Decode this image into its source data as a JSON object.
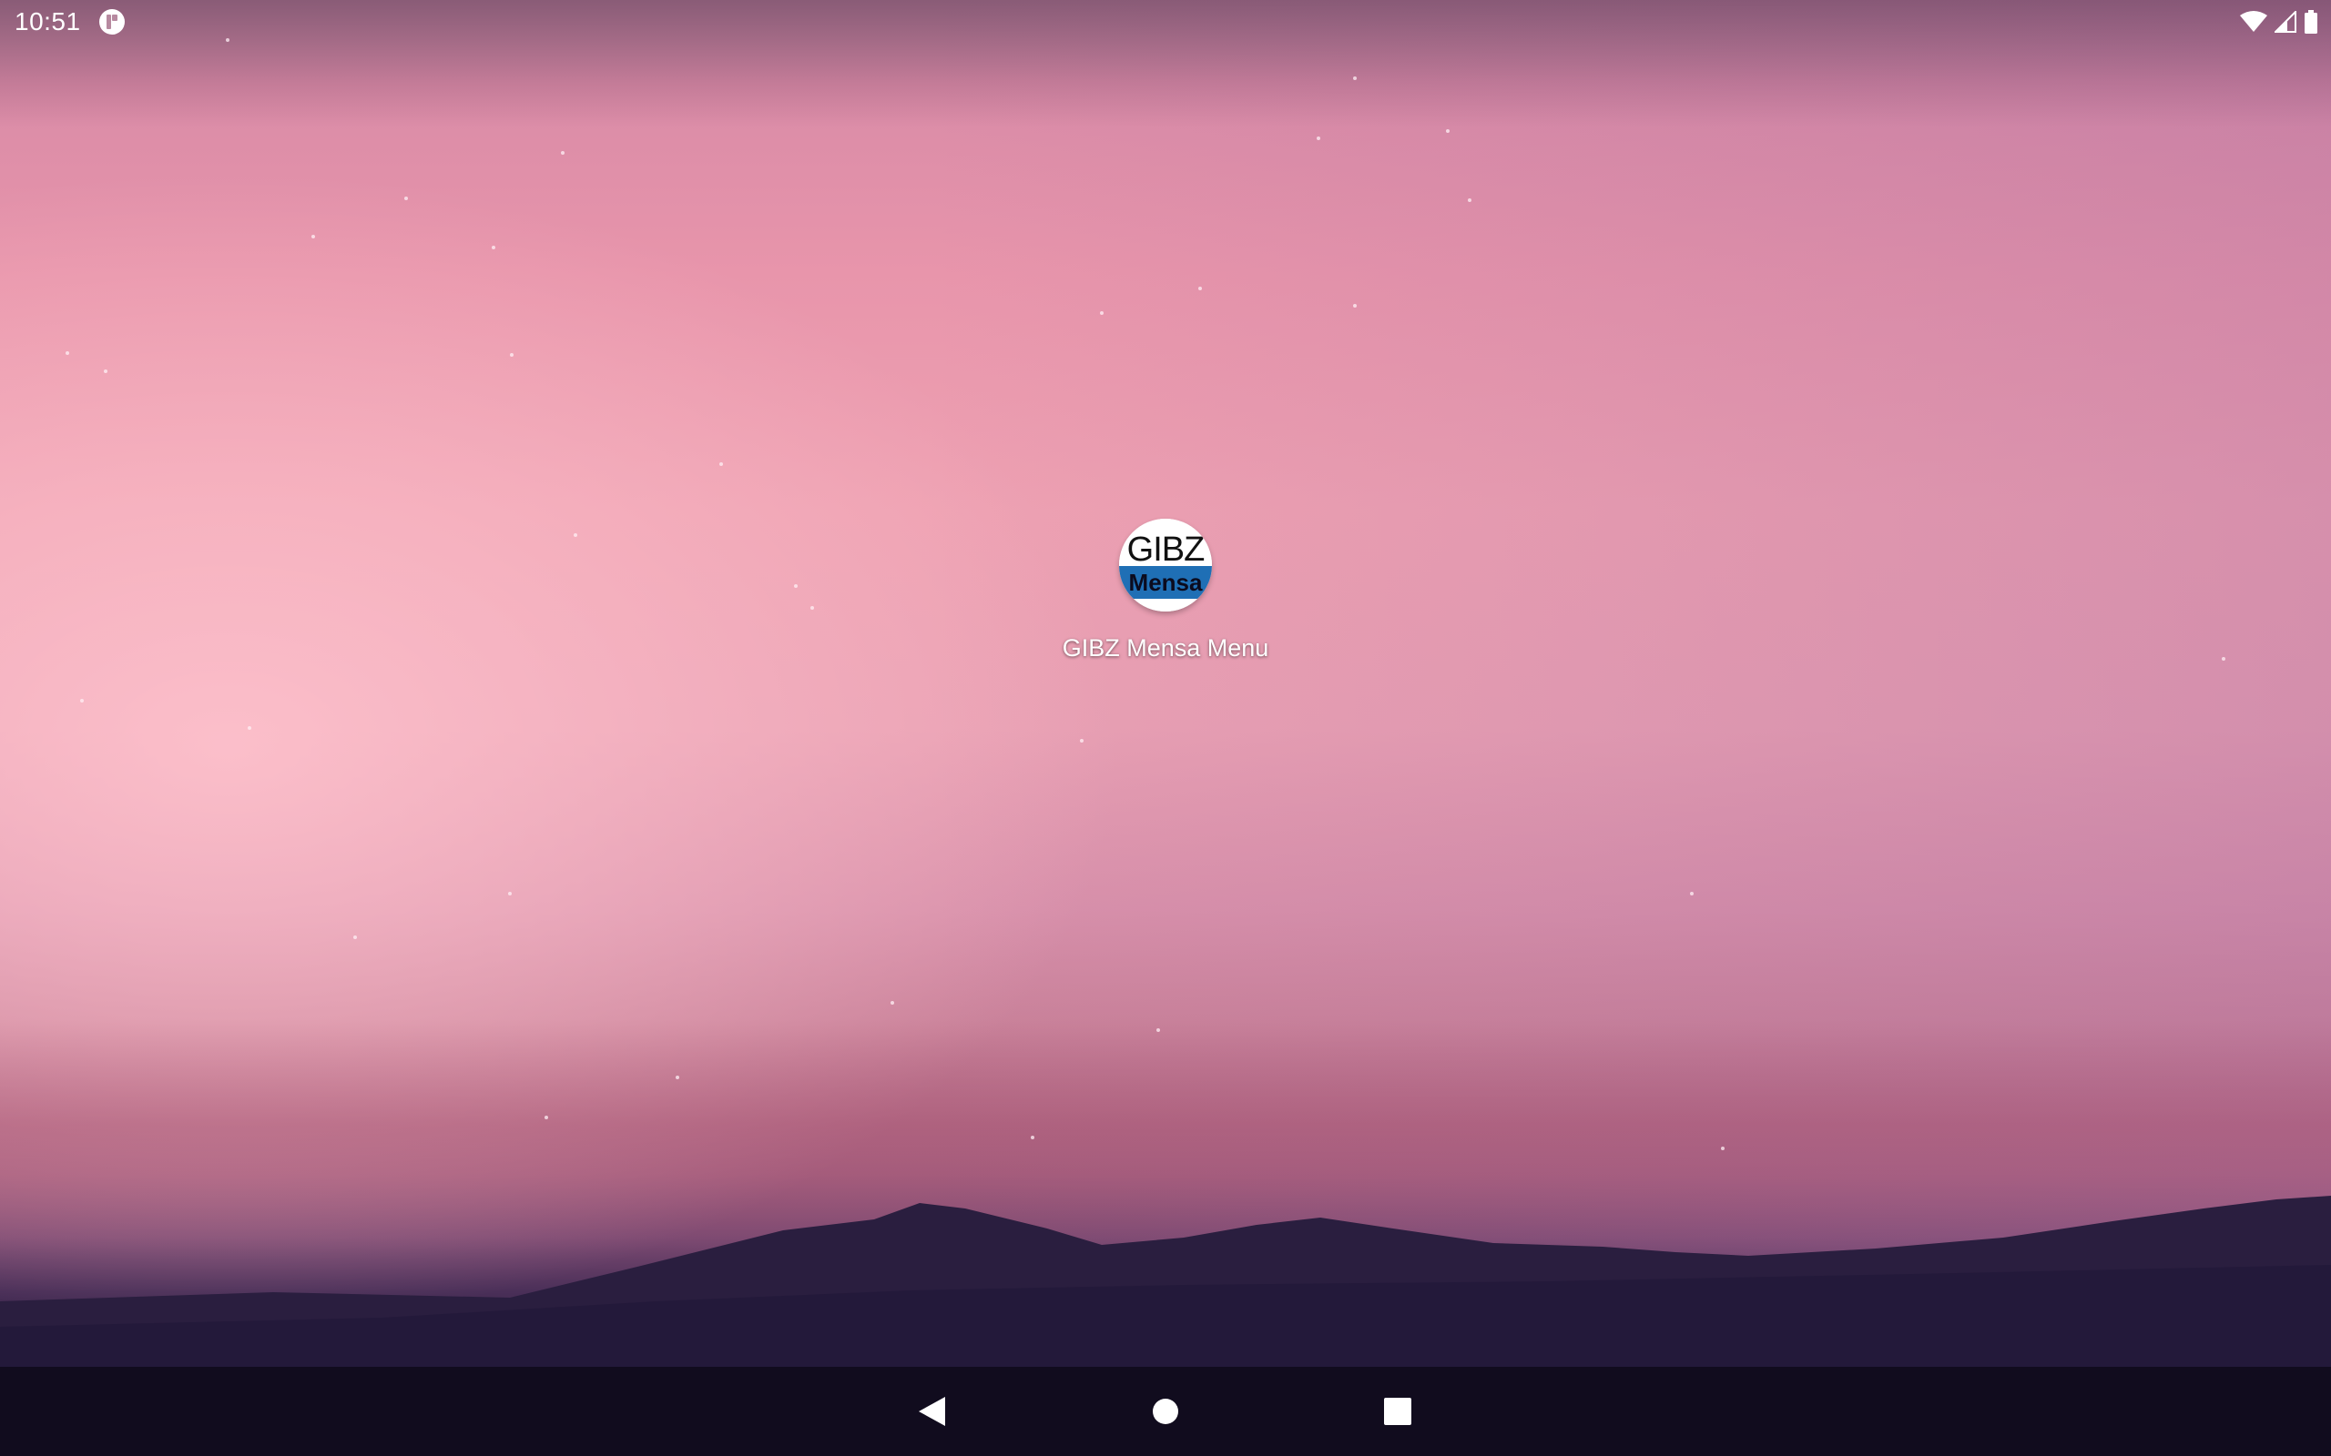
{
  "status_bar": {
    "time": "10:51",
    "notification_icon": "notification-app-icon",
    "icons": [
      "wifi-icon",
      "cellular-signal-icon",
      "battery-icon"
    ]
  },
  "home": {
    "apps": [
      {
        "label": "GIBZ Mensa Menu",
        "icon_text_top": "GIBZ",
        "icon_text_bottom": "Mensa",
        "icon_colors": {
          "top": "#ffffff",
          "band": "#1f6fb5"
        }
      }
    ]
  },
  "nav_bar": {
    "buttons": [
      "back-icon",
      "home-icon",
      "recents-icon"
    ]
  },
  "colors": {
    "nav_bar_bg": "#110c1e",
    "sky_pink": "#eea1b2",
    "mountains": "#2a1e3f"
  }
}
